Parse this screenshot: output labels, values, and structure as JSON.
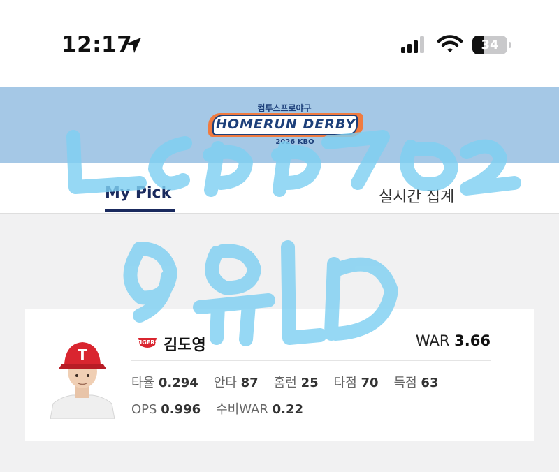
{
  "status_bar": {
    "time": "12:17",
    "battery": "34",
    "battery_level": 0.34,
    "icons": [
      "location-arrow-icon",
      "cellular-signal-icon",
      "wifi-icon",
      "battery-icon"
    ]
  },
  "banner": {
    "logo_top": "컴투스프로야구",
    "logo_main": "HOMERUN DERBY",
    "logo_sub": "2026 KBO",
    "background": "#a5c8e6",
    "accent": "#f07b40",
    "brand": "#1c3f7a"
  },
  "tabs": [
    {
      "label": "My Pick",
      "active": true
    },
    {
      "label": "실시간 집계",
      "active": false
    }
  ],
  "player": {
    "name": "김도영",
    "war_label": "WAR",
    "war_value": "3.66",
    "stats": [
      {
        "label": "타율",
        "value": "0.294"
      },
      {
        "label": "안타",
        "value": "87"
      },
      {
        "label": "홈런",
        "value": "25"
      },
      {
        "label": "타점",
        "value": "70"
      },
      {
        "label": "득점",
        "value": "63"
      },
      {
        "label": "OPS",
        "value": "0.996"
      },
      {
        "label": "수비WAR",
        "value": "0.22"
      }
    ],
    "team_logo": "tigers-logo-icon",
    "cap_color": "#d9252f"
  },
  "scribble": {
    "color": "#7fd0f2"
  }
}
